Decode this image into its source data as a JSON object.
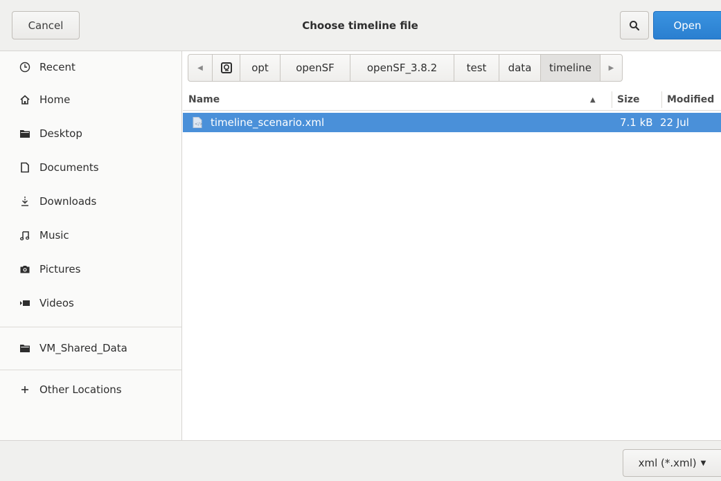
{
  "header": {
    "title": "Choose timeline file",
    "cancel_label": "Cancel",
    "open_label": "Open",
    "search_icon": "search-icon"
  },
  "sidebar": {
    "items": [
      {
        "label": "Recent",
        "icon": "clock-icon"
      },
      {
        "label": "Home",
        "icon": "home-icon"
      },
      {
        "label": "Desktop",
        "icon": "folder-icon"
      },
      {
        "label": "Documents",
        "icon": "document-icon"
      },
      {
        "label": "Downloads",
        "icon": "download-icon"
      },
      {
        "label": "Music",
        "icon": "music-icon"
      },
      {
        "label": "Pictures",
        "icon": "camera-icon"
      },
      {
        "label": "Videos",
        "icon": "video-icon"
      }
    ],
    "bookmarks": [
      {
        "label": "VM_Shared_Data",
        "icon": "folder-icon"
      }
    ],
    "other_locations": {
      "label": "Other Locations",
      "icon": "plus-icon"
    }
  },
  "pathbar": {
    "crumbs": [
      "opt",
      "openSF",
      "openSF_3.8.2",
      "test",
      "data",
      "timeline"
    ],
    "current": "timeline"
  },
  "file_list": {
    "columns": {
      "name": "Name",
      "size": "Size",
      "modified": "Modified"
    },
    "rows": [
      {
        "name": "timeline_scenario.xml",
        "size": "7.1 kB",
        "modified": "22 Jul",
        "selected": true
      }
    ]
  },
  "footer": {
    "filter_label": "xml (*.xml)"
  },
  "colors": {
    "accent": "#4a90d9",
    "open_button": "#2a7fd0"
  }
}
